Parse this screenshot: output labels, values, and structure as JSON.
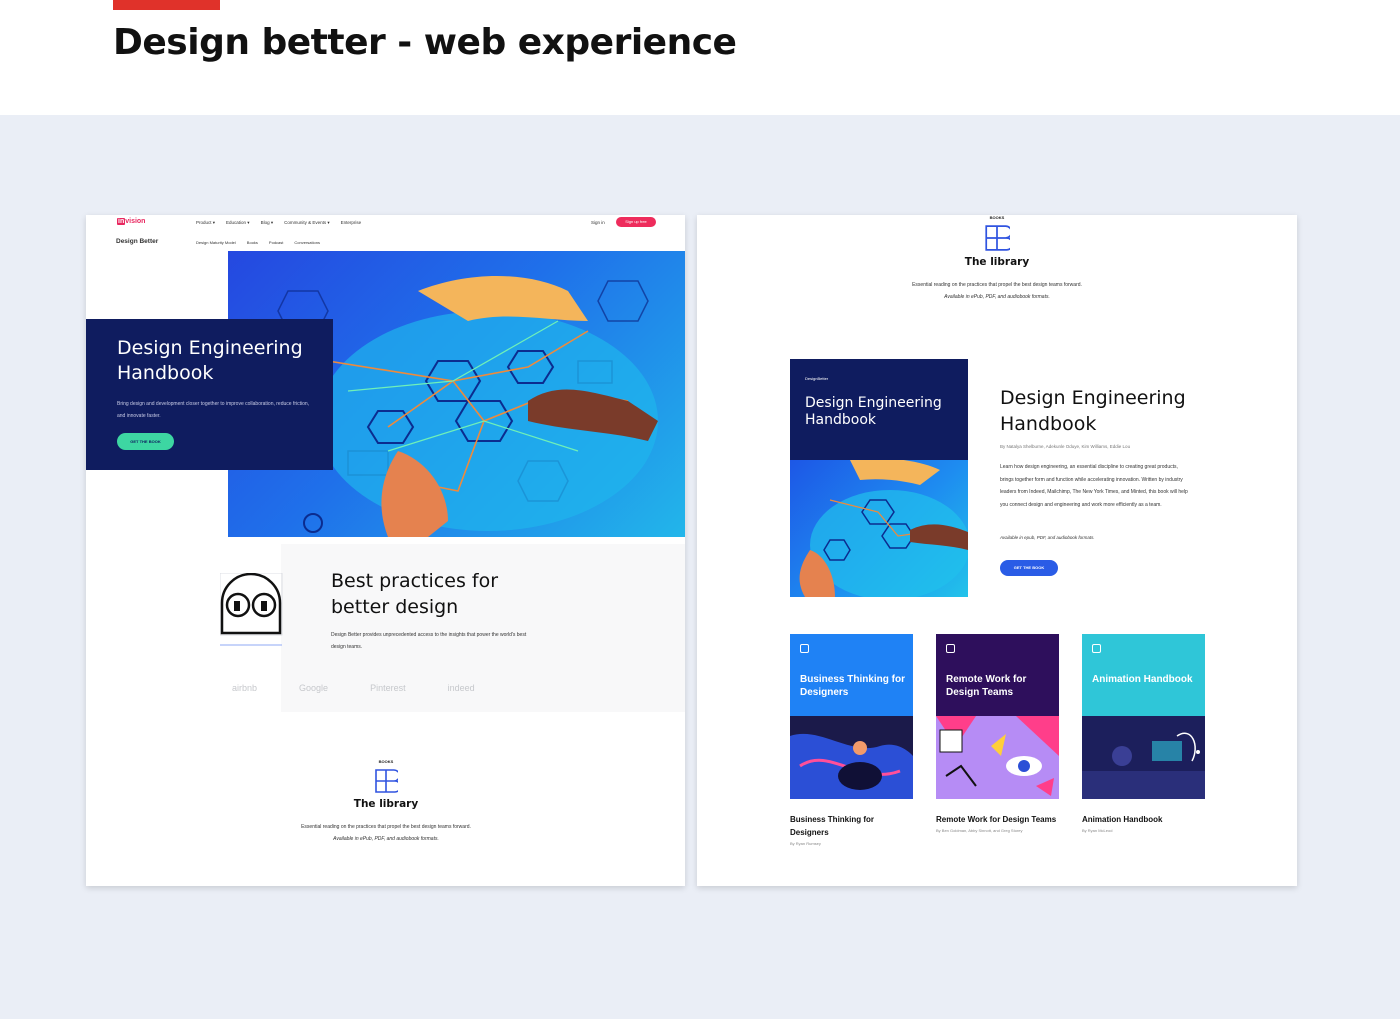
{
  "heading": "Design better - web experience",
  "colors": {
    "accent_red": "#e0322a",
    "navy": "#0f1c5f",
    "green_cta": "#3dd6a2",
    "blue_cta": "#2a5ce6",
    "stage_bg": "#eaeef6"
  },
  "left": {
    "nav": {
      "logo_badge": "in",
      "logo_rest": "vision",
      "links": [
        "Product ▾",
        "Education ▾",
        "Blog ▾",
        "Community & Events ▾",
        "Enterprise"
      ],
      "sign_in": "Sign in",
      "sign_up": "Sign up free",
      "brand": "Design Better",
      "subnav": [
        "Design Maturity Model",
        "Books",
        "Podcast",
        "Conversations"
      ]
    },
    "hero": {
      "title": "Design Engineering Handbook",
      "description": "Bring design and development closer together to improve collaboration, reduce friction, and innovate faster.",
      "cta": "GET THE BOOK"
    },
    "best_practices": {
      "title": "Best practices for better design",
      "description": "Design Better provides unprecedented access to the insights that power the world's best design teams.",
      "logos": [
        "airbnb",
        "Google",
        "Pinterest",
        "indeed"
      ]
    },
    "library": {
      "eyebrow": "BOOKS",
      "title": "The library",
      "description": "Essential reading on the practices that propel the best design teams forward.",
      "availability": "Available in ePub, PDF, and audiobook formats."
    }
  },
  "right": {
    "library": {
      "eyebrow": "BOOKS",
      "title": "The library",
      "description": "Essential reading on the practices that propel the best design teams forward.",
      "availability": "Available in ePub, PDF, and audiobook formats."
    },
    "featured": {
      "cover_brand": "DesignBetter",
      "cover_title": "Design Engineering Handbook",
      "title": "Design Engineering Handbook",
      "authors": "By Natalya Shelburne, Adekunle Oduye, Kim Williams, Eddie Lou",
      "description": "Learn how design engineering, an essential discipline to creating great products, brings together form and function while accelerating innovation. Written by industry leaders from Indeed, Mailchimp, The New York Times, and Minted, this book will help you connect design and engineering and work more efficiently as a team.",
      "availability": "Available in epub, PDF, and audiobook formats.",
      "cta": "GET THE BOOK"
    },
    "books": [
      {
        "cover_name": "Business Thinking for Designers",
        "title": "Business Thinking for Designers",
        "author": "By Ryan Rumsey",
        "color": "#1f82f5"
      },
      {
        "cover_name": "Remote Work for Design Teams",
        "title": "Remote Work for Design Teams",
        "author": "By Ben Goldman, Abby Sinnott, and Greg Storey",
        "color": "#2e0f5c"
      },
      {
        "cover_name": "Animation Handbook",
        "title": "Animation Handbook",
        "author": "By Ryan McLeod",
        "color": "#2fc6d8"
      }
    ]
  }
}
